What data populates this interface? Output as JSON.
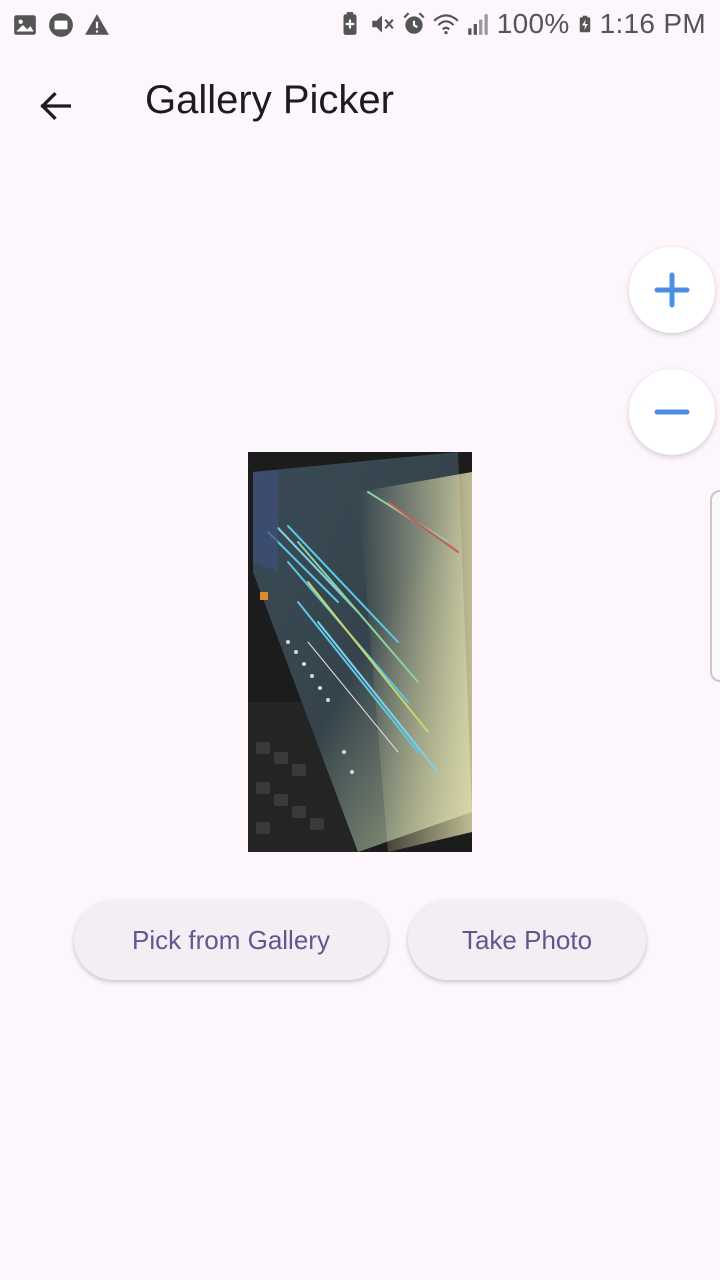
{
  "status_bar": {
    "battery": "100%",
    "time": "1:16 PM",
    "left_icons": [
      "image-icon",
      "cast-icon",
      "warning-icon"
    ],
    "right_icons": [
      "battery-saver-icon",
      "mute-icon",
      "alarm-icon",
      "wifi-icon",
      "signal-icon",
      "battery-charging-icon"
    ]
  },
  "app_bar": {
    "title": "Gallery Picker",
    "back_icon": "arrow-back-icon"
  },
  "zoom": {
    "zoom_in_icon": "plus-icon",
    "zoom_out_icon": "minus-icon",
    "accent": "#4a8ee6"
  },
  "preview": {
    "icon": "photo-preview"
  },
  "actions": {
    "pick_label": "Pick from Gallery",
    "take_label": "Take Photo"
  },
  "colors": {
    "background": "#fdf7fd",
    "button_bg": "#f3eef4",
    "button_text": "#65558f"
  }
}
